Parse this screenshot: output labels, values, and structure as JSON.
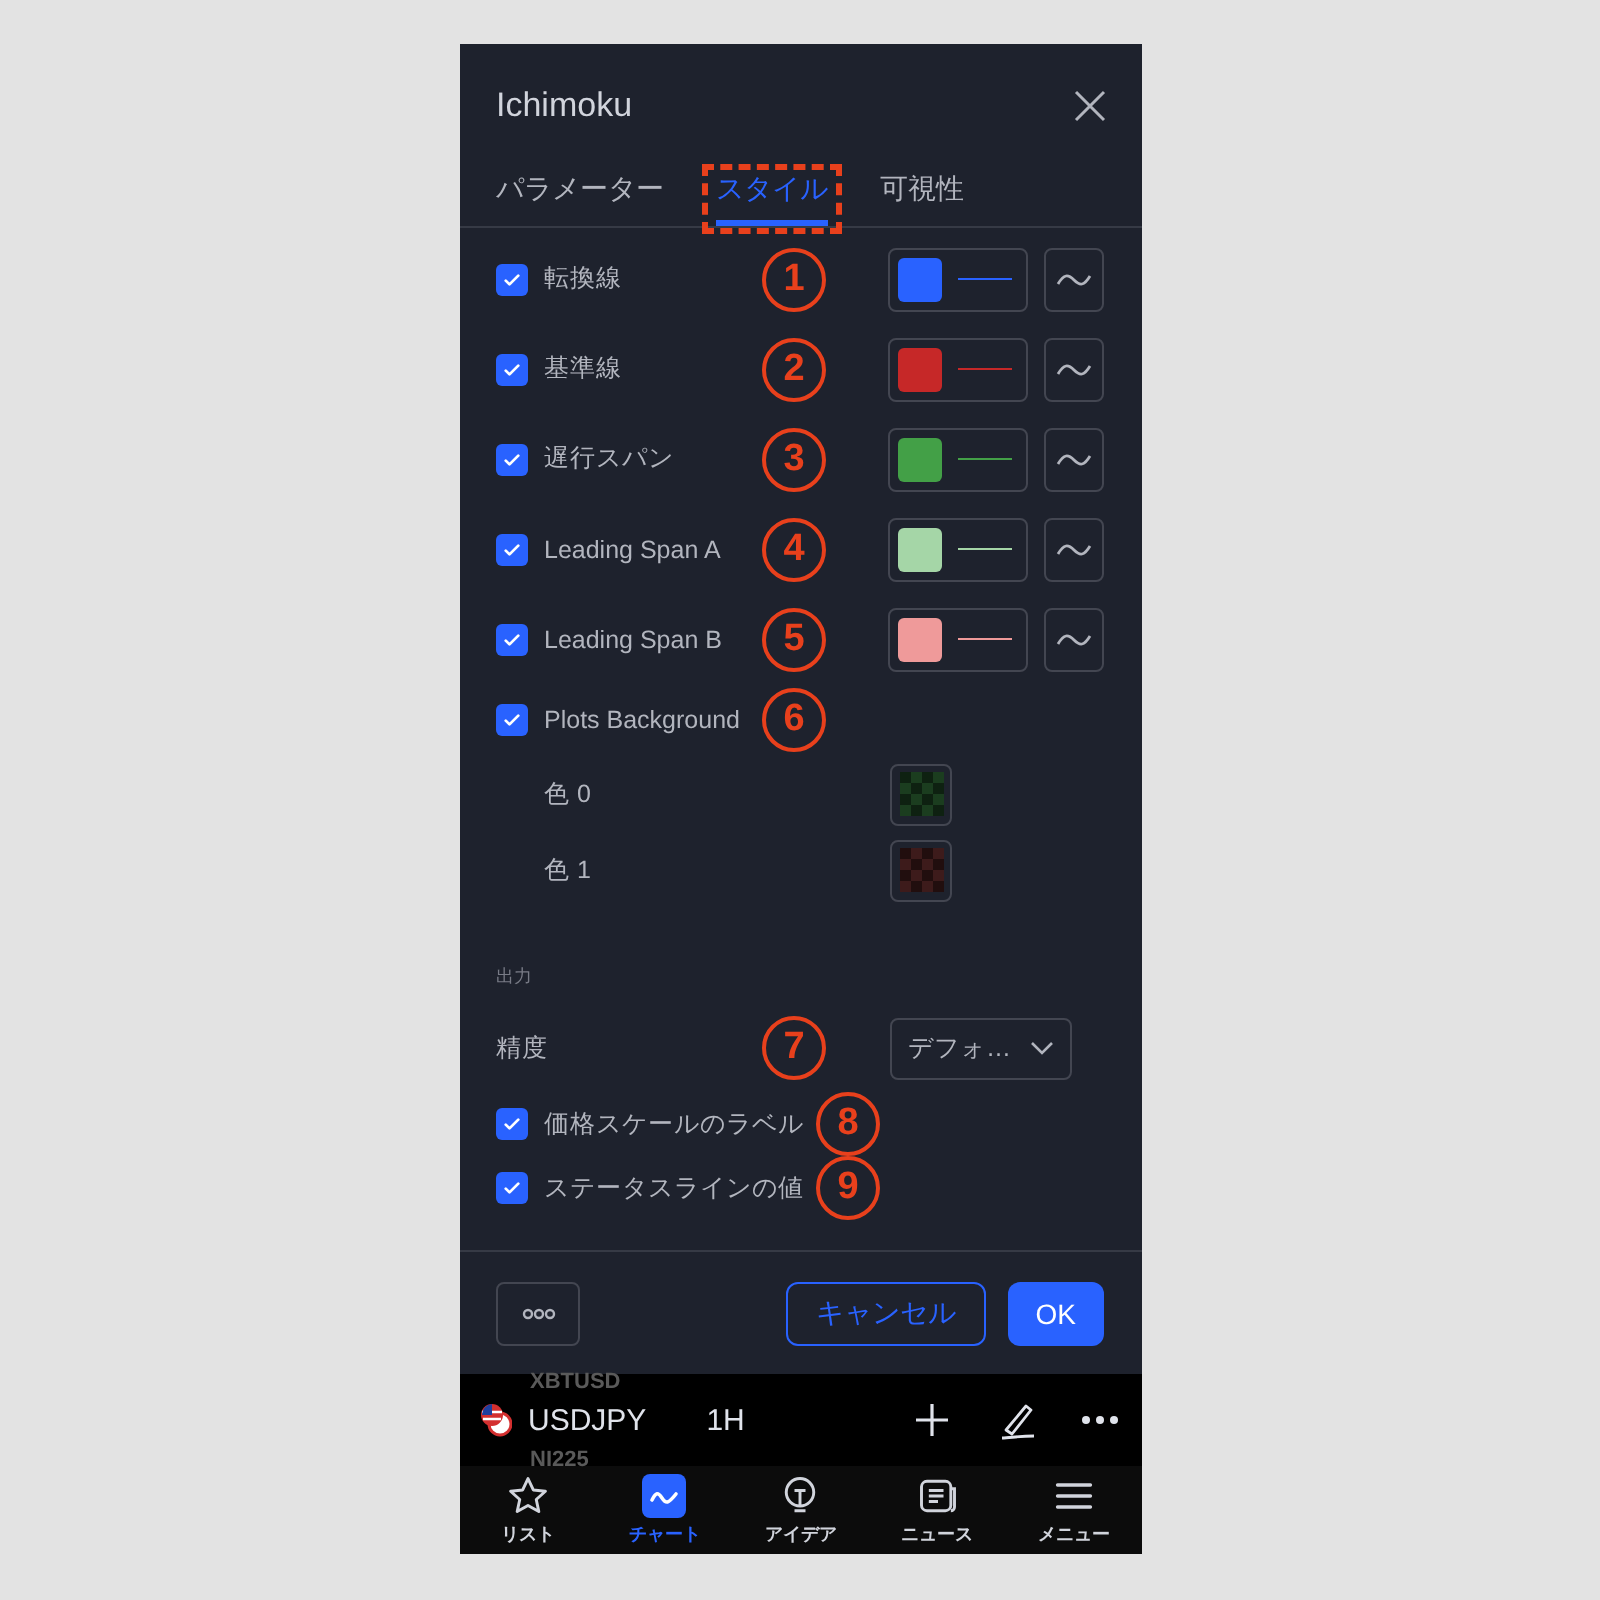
{
  "dialog": {
    "title": "Ichimoku"
  },
  "tabs": [
    {
      "label": "パラメーター",
      "selected": false,
      "highlighted": false
    },
    {
      "label": "スタイル",
      "selected": true,
      "highlighted": true
    },
    {
      "label": "可視性",
      "selected": false,
      "highlighted": false
    }
  ],
  "rows": [
    {
      "kind": "plot",
      "label": "転換線",
      "checked": true,
      "marker": "1",
      "color": "#2962ff"
    },
    {
      "kind": "plot",
      "label": "基準線",
      "checked": true,
      "marker": "2",
      "color": "#c62828"
    },
    {
      "kind": "plot",
      "label": "遅行スパン",
      "checked": true,
      "marker": "3",
      "color": "#43a047"
    },
    {
      "kind": "plot",
      "label": "Leading Span A",
      "checked": true,
      "marker": "4",
      "color": "#a5d6a7"
    },
    {
      "kind": "plot",
      "label": "Leading Span B",
      "checked": true,
      "marker": "5",
      "color": "#ef9a9a"
    },
    {
      "kind": "toggle",
      "label": "Plots Background",
      "checked": true,
      "marker": "6"
    },
    {
      "kind": "color",
      "label": "色 0",
      "color": "#1b3d1f"
    },
    {
      "kind": "color",
      "label": "色 1",
      "color": "#3d1b1b"
    }
  ],
  "output_section": {
    "title": "出力",
    "rows": [
      {
        "kind": "select",
        "label": "精度",
        "marker": "7",
        "value": "デフォ…"
      },
      {
        "kind": "check",
        "label": "価格スケールのラベル",
        "checked": true,
        "marker": "8"
      },
      {
        "kind": "check",
        "label": "ステータスラインの値",
        "checked": true,
        "marker": "9"
      }
    ]
  },
  "footer": {
    "cancel": "キャンセル",
    "ok": "OK"
  },
  "symbol_bar": {
    "symbol": "USDJPY",
    "interval": "1H",
    "ghost_above": "XBTUSD",
    "ghost_below": "NI225"
  },
  "nav": [
    {
      "kind": "star",
      "label": "リスト",
      "selected": false
    },
    {
      "kind": "chart",
      "label": "チャート",
      "selected": true
    },
    {
      "kind": "bulb",
      "label": "アイデア",
      "selected": false
    },
    {
      "kind": "news",
      "label": "ニュース",
      "selected": false
    },
    {
      "kind": "menu",
      "label": "メニュー",
      "selected": false
    }
  ]
}
